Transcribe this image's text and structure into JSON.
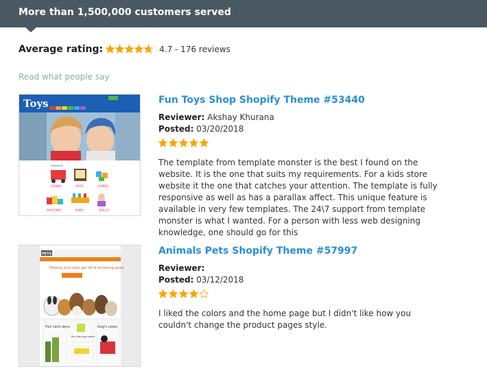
{
  "header": {
    "title": "More than 1,500,000 customers served"
  },
  "rating": {
    "label": "Average rating:",
    "value": 4.7,
    "summary": "4.7 - 176 reviews"
  },
  "read_label": "Read what people say",
  "colors": {
    "accent": "#2a8ed6",
    "star": "#f7a600",
    "header_bg": "#4a5862"
  },
  "reviews": [
    {
      "title": "Fun Toys Shop Shopify Theme #53440",
      "reviewer_label": "Reviewer:",
      "reviewer": "Akshay Khurana",
      "posted_label": "Posted:",
      "posted": "03/20/2018",
      "stars": 5,
      "text": "The template from template monster is the best I found on the website. It is the one that suits my requirements. For a kids store website it the one that catches your attention. The template is fully responsive as well as has a parallax affect. This unique feature is available in very few templates. The 24\\7 support from template monster is what I wanted. For a person with less web designing knowledge, one should go for this",
      "thumb": {
        "logo": "Toys",
        "cats": [
          "RIDING",
          "ARTS",
          "GAMES",
          "BUILDING",
          "BABY",
          "DOLLS"
        ],
        "feature": "Featured"
      }
    },
    {
      "title": "Animals Pets Shopify Theme #57997",
      "reviewer_label": "Reviewer:",
      "reviewer": "",
      "posted_label": "Posted:",
      "posted": "03/12/2018",
      "stars": 4,
      "text": "I liked the colors and the home page but I didn't like how you couldn't change the product pages style.",
      "thumb": {
        "logo": "PETS",
        "headline": "Helping your pets get rid of annoying pests",
        "cats": [
          "Fish tank decor",
          "Buy two dog cookie get one free",
          "Dog's coats"
        ]
      }
    }
  ]
}
